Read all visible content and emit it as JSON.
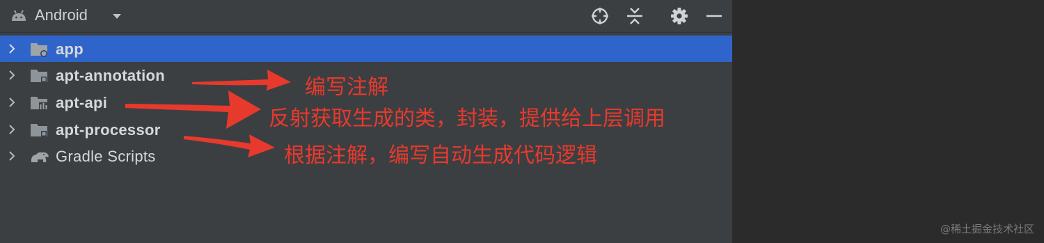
{
  "toolbar": {
    "view_mode": "Android",
    "icons": [
      "android-icon",
      "dropdown-caret-icon",
      "locate-target-icon",
      "collapse-all-icon",
      "gear-icon",
      "hide-minus-icon"
    ]
  },
  "tree": {
    "items": [
      {
        "label": "app",
        "icon": "module-folder-icon",
        "selected": true
      },
      {
        "label": "apt-annotation",
        "icon": "module-folder-icon",
        "selected": false
      },
      {
        "label": "apt-api",
        "icon": "library-module-icon",
        "selected": false
      },
      {
        "label": "apt-processor",
        "icon": "module-folder-icon",
        "selected": false
      },
      {
        "label": "Gradle Scripts",
        "icon": "gradle-elephant-icon",
        "selected": false
      }
    ]
  },
  "annotations": [
    {
      "text": "编写注解",
      "target": "apt-annotation"
    },
    {
      "text": "反射获取生成的类，封装，提供给上层调用",
      "target": "apt-api"
    },
    {
      "text": "根据注解，编写自动生成代码逻辑",
      "target": "apt-processor"
    }
  ],
  "watermark": "@稀土掘金技术社区",
  "colors": {
    "panel_bg": "#3c3f41",
    "editor_bg": "#2b2b2b",
    "selection": "#2f65ca",
    "annotation_red": "#e8392d",
    "text": "#d6d8da"
  }
}
